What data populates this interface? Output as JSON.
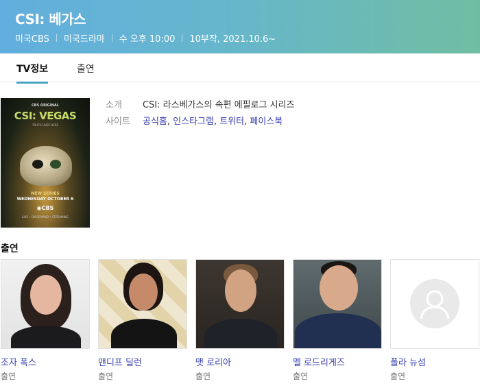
{
  "header": {
    "title": "CSI: 베가스",
    "meta": [
      "미국CBS",
      "미국드라마",
      "수 오후 10:00",
      "10부작, 2021.10.6~"
    ],
    "colors": {
      "gradient_start": "#62aede",
      "gradient_end": "#70bea2"
    }
  },
  "tabs": [
    {
      "label": "TV정보",
      "active": true
    },
    {
      "label": "출연",
      "active": false
    }
  ],
  "poster": {
    "network_small": "CBS ORIGINAL",
    "title": "CSI: VEGAS",
    "tagline": "TRUTH LIVES HERE",
    "series_text": "NEW SERIES",
    "premiere_text": "WEDNESDAY OCTOBER 6",
    "network": "◉CBS",
    "stream_text": "LIVE • ON DEMAND • STREAMING"
  },
  "info": {
    "intro_label": "소개",
    "intro_value": "CSI: 라스베가스의 속편 에필로그 시리즈",
    "site_label": "사이트",
    "sites": [
      "공식홈",
      "인스타그램",
      "트위터",
      "페이스북"
    ]
  },
  "cast_heading": "출연",
  "cast": [
    {
      "name": "조자 폭스",
      "role": "출연"
    },
    {
      "name": "맨디프 딜런",
      "role": "출연"
    },
    {
      "name": "맷 로리아",
      "role": "출연"
    },
    {
      "name": "멜 로드리게즈",
      "role": "출연"
    },
    {
      "name": "폴라 뉴섬",
      "role": "출연"
    }
  ],
  "link_color": "#3a3fb0",
  "accent_color": "#48a3c4"
}
